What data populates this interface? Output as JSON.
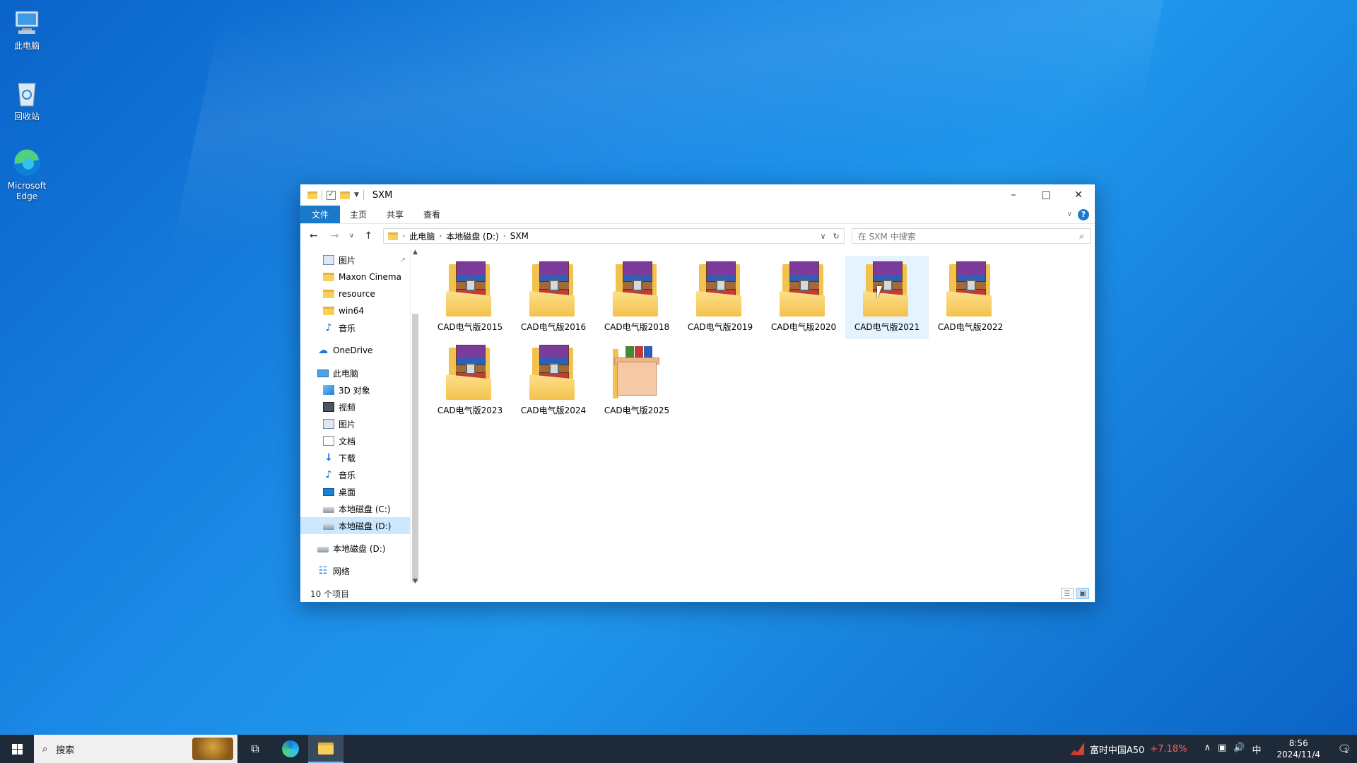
{
  "desktop": {
    "icons": [
      {
        "label": "此电脑",
        "icon": "computer-icon"
      },
      {
        "label": "回收站",
        "icon": "recycle-bin-icon"
      },
      {
        "label": "Microsoft Edge",
        "icon": "edge-icon"
      }
    ]
  },
  "window": {
    "title": "SXM",
    "ribbon_tabs": [
      "文件",
      "主页",
      "共享",
      "查看"
    ],
    "help_label": "?",
    "address": {
      "crumbs": [
        "此电脑",
        "本地磁盘 (D:)",
        "SXM"
      ]
    },
    "search": {
      "placeholder": "在 SXM 中搜索"
    },
    "nav": {
      "quick": [
        {
          "label": "图片",
          "icon": "pictures-icon",
          "pinned": true
        },
        {
          "label": "Maxon Cinema",
          "icon": "folder-icon"
        },
        {
          "label": "resource",
          "icon": "folder-icon"
        },
        {
          "label": "win64",
          "icon": "folder-icon"
        },
        {
          "label": "音乐",
          "icon": "music-icon"
        }
      ],
      "onedrive": "OneDrive",
      "thispc": "此电脑",
      "pc_items": [
        {
          "label": "3D 对象",
          "icon": "3d-objects-icon"
        },
        {
          "label": "视频",
          "icon": "videos-icon"
        },
        {
          "label": "图片",
          "icon": "pictures-icon"
        },
        {
          "label": "文档",
          "icon": "documents-icon"
        },
        {
          "label": "下载",
          "icon": "downloads-icon"
        },
        {
          "label": "音乐",
          "icon": "music-icon"
        },
        {
          "label": "桌面",
          "icon": "desktop-icon"
        },
        {
          "label": "本地磁盘 (C:)",
          "icon": "drive-icon"
        },
        {
          "label": "本地磁盘 (D:)",
          "icon": "drive-icon",
          "selected": true
        }
      ],
      "drive_d": "本地磁盘 (D:)",
      "network": "网络"
    },
    "files": [
      {
        "name": "CAD电气版2015",
        "type": "archive"
      },
      {
        "name": "CAD电气版2016",
        "type": "archive"
      },
      {
        "name": "CAD电气版2018",
        "type": "archive"
      },
      {
        "name": "CAD电气版2019",
        "type": "archive"
      },
      {
        "name": "CAD电气版2020",
        "type": "archive"
      },
      {
        "name": "CAD电气版2021",
        "type": "archive",
        "hover": true
      },
      {
        "name": "CAD电气版2022",
        "type": "archive"
      },
      {
        "name": "CAD电气版2023",
        "type": "archive"
      },
      {
        "name": "CAD电气版2024",
        "type": "archive"
      },
      {
        "name": "CAD电气版2025",
        "type": "installer"
      }
    ],
    "status": "10 个项目"
  },
  "taskbar": {
    "search_label": "搜索",
    "stock_name": "富时中国A50",
    "stock_change": "+7.18%",
    "ime": "中",
    "time": "8:56",
    "date": "2024/11/4",
    "notification_count": "1"
  },
  "colors": {
    "accent": "#1979ca",
    "selection": "#cce8ff",
    "hover": "#e5f3ff",
    "stock_up": "#ff5b5b"
  }
}
